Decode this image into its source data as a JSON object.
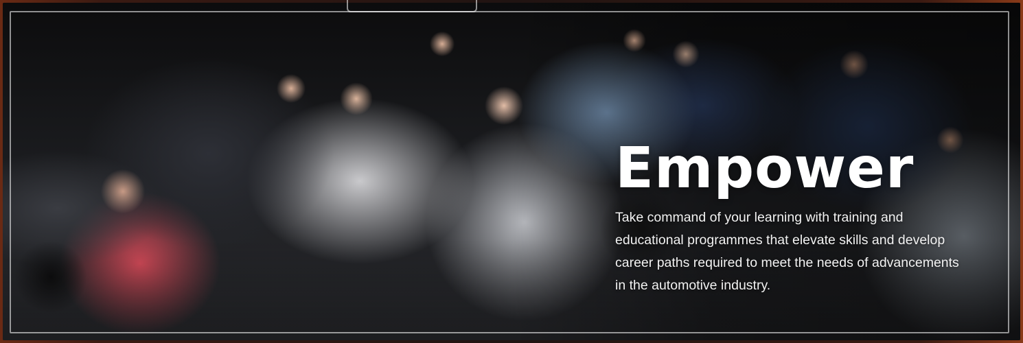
{
  "hero": {
    "headline": "Empower",
    "description": "Take command of your learning with training and educational programmes that elevate skills and develop career paths required to meet the needs of advancements in the automotive industry."
  },
  "colors": {
    "text": "#ffffff",
    "frame_accent": "#8a3a18",
    "border": "#ffffff"
  }
}
